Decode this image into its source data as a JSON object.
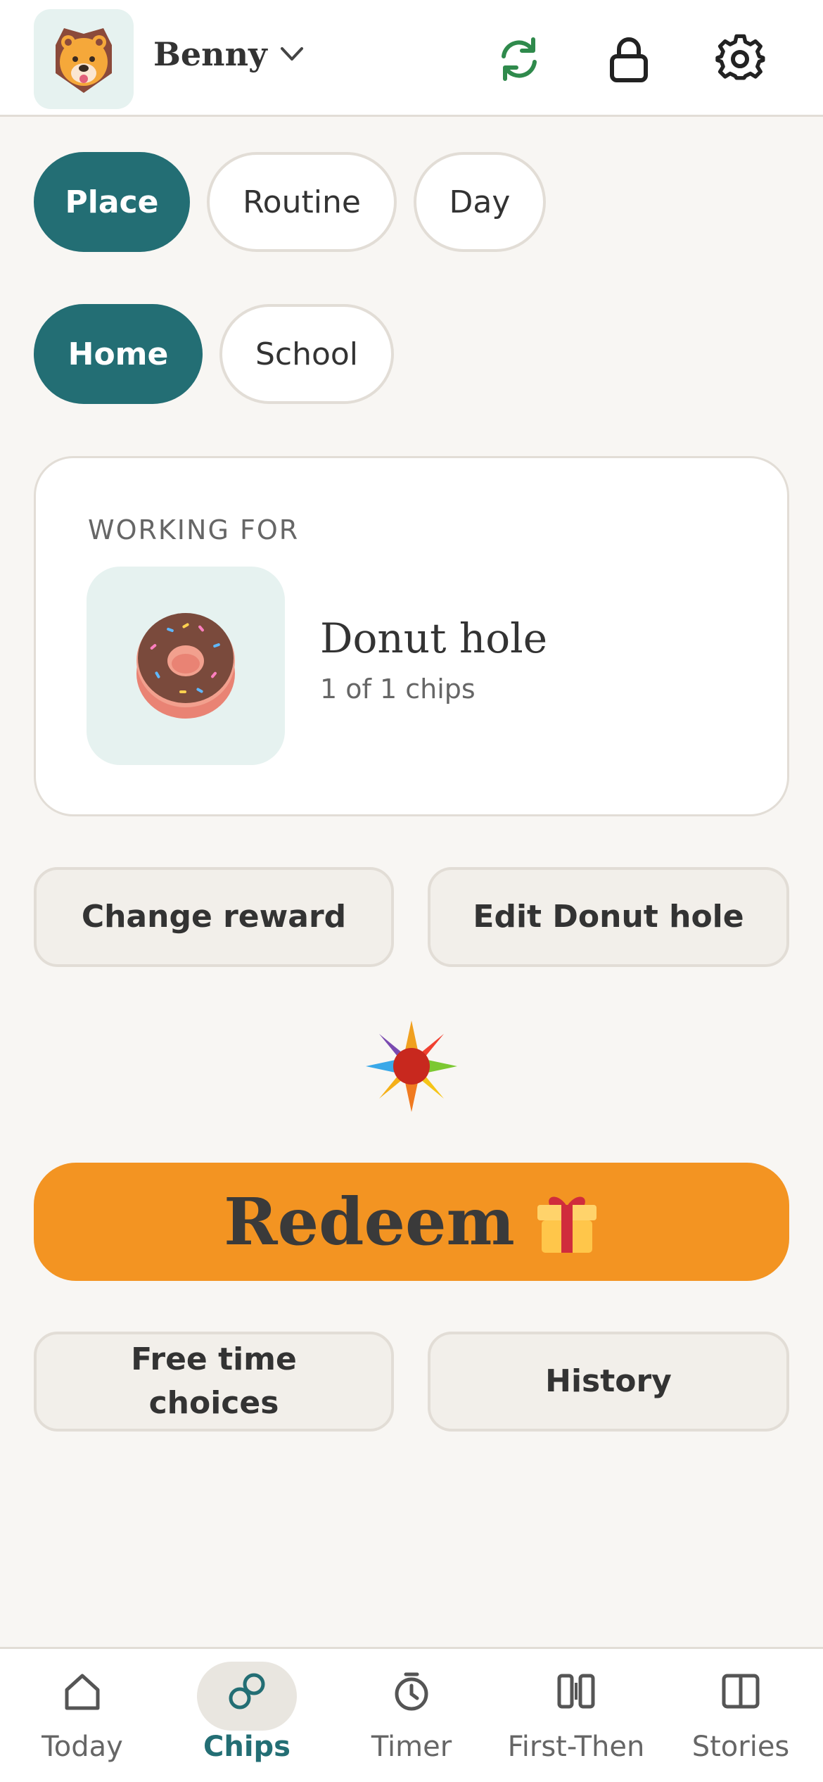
{
  "header": {
    "profile_name": "Benny",
    "avatar_icon": "lion-icon",
    "actions": [
      "sync-icon",
      "lock-icon",
      "gear-icon"
    ],
    "sync_color": "#2f8a4c"
  },
  "place_tabs": [
    "Place",
    "Routine",
    "Day"
  ],
  "place_options": [
    "Home",
    "School"
  ],
  "working_for": {
    "label": "WORKING FOR",
    "reward_name": "Donut hole",
    "progress": "1 of 1 chips",
    "reward_icon": "donut-icon"
  },
  "actions": {
    "change_reward": "Change reward",
    "edit_reward": "Edit Donut hole",
    "redeem": "Redeem",
    "free_time_line1": "Free time",
    "free_time_line2": "choices",
    "history": "History"
  },
  "nav": [
    {
      "label": "Today",
      "icon": "home-icon"
    },
    {
      "label": "Chips",
      "icon": "chips-icon"
    },
    {
      "label": "Timer",
      "icon": "timer-icon"
    },
    {
      "label": "First-Then",
      "icon": "first-then-icon"
    },
    {
      "label": "Stories",
      "icon": "stories-icon"
    }
  ],
  "colors": {
    "accent": "#236e74",
    "redeem": "#f39422",
    "background": "#f8f6f3",
    "tile": "#e6f2f0"
  }
}
